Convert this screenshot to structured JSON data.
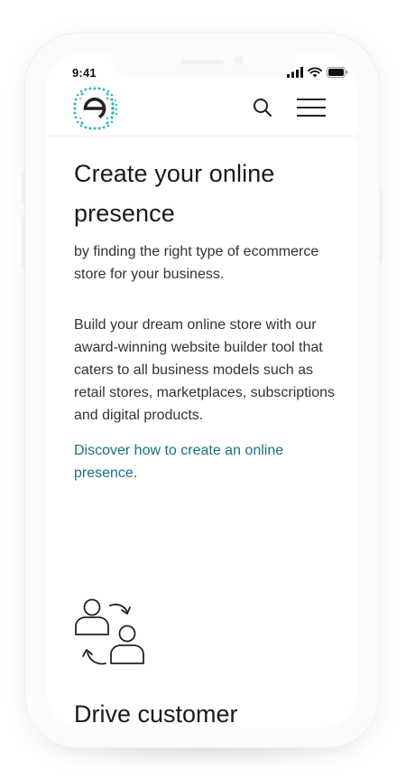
{
  "status_bar": {
    "time": "9:41",
    "signal_icon": "cellular-signal-icon",
    "wifi_icon": "wifi-icon",
    "battery_icon": "battery-icon"
  },
  "header": {
    "logo_icon": "ecommerce-e-logo",
    "search_icon": "search-icon",
    "menu_icon": "hamburger-menu-icon"
  },
  "main": {
    "headline": "Create your online presence",
    "subhead": "by finding the right type of ecommerce store for your business.",
    "body": "Build your dream online store with our award-winning website builder tool that caters to all business models such as retail stores, marketplaces, subscriptions and digital products.",
    "link_label": "Discover how to create an online presence."
  },
  "section2": {
    "icon": "customers-exchange-icon",
    "title": "Drive customer"
  },
  "colors": {
    "brand_teal": "#2fb8c3",
    "link": "#1a6f86",
    "text": "#1a1a1a"
  }
}
